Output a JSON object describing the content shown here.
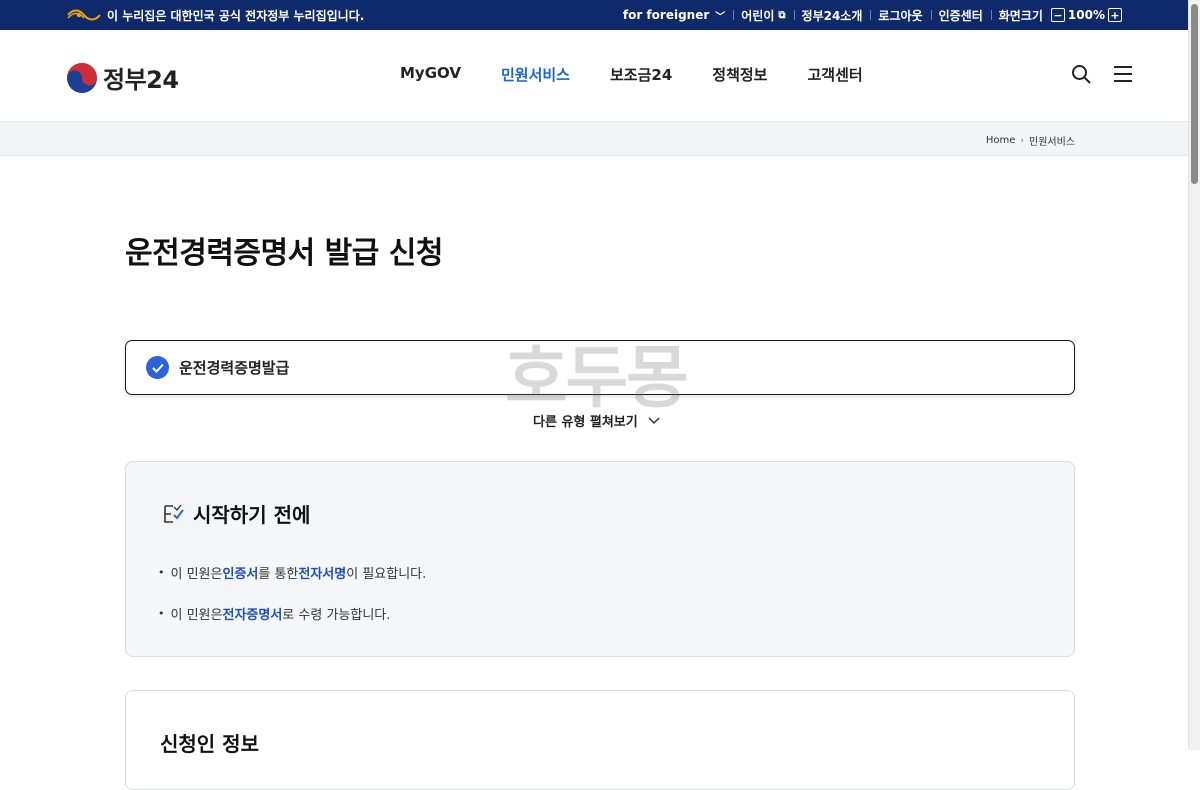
{
  "gov_bar": {
    "notice": "이 누리집은 대한민국 공식 전자정부 누리집입니다.",
    "links": [
      {
        "label": "for foreigner"
      },
      {
        "label": "어린이"
      },
      {
        "label": "정부24소개"
      },
      {
        "label": "로그아웃"
      },
      {
        "label": "인증센터"
      },
      {
        "label": "화면크기"
      }
    ],
    "zoom_level": "100%"
  },
  "header": {
    "logo_text": "정부24",
    "nav": [
      {
        "label": "MyGOV",
        "active": false
      },
      {
        "label": "민원서비스",
        "active": true
      },
      {
        "label": "보조금24",
        "active": false
      },
      {
        "label": "정책정보",
        "active": false
      },
      {
        "label": "고객센터",
        "active": false
      }
    ],
    "accent_color": "#1a64d6"
  },
  "breadcrumb": {
    "home": "Home",
    "current": "민원서비스"
  },
  "page": {
    "title": "운전경력증명서 발급 신청",
    "selected_type": "운전경력증명발급",
    "more_types_label": "다른 유형 펼쳐보기",
    "watermark": "호두몽"
  },
  "before_start": {
    "title": "시작하기 전에",
    "notice1": {
      "pre": "이 민원은 ",
      "hl1": "인증서",
      "mid": "를 통한 ",
      "hl2": "전자서명",
      "post": "이 필요합니다."
    },
    "notice2": {
      "pre": "이 민원은 ",
      "hl1": "전자증명서",
      "post": "로 수령 가능합니다."
    }
  },
  "applicant": {
    "title": "신청인 정보"
  }
}
